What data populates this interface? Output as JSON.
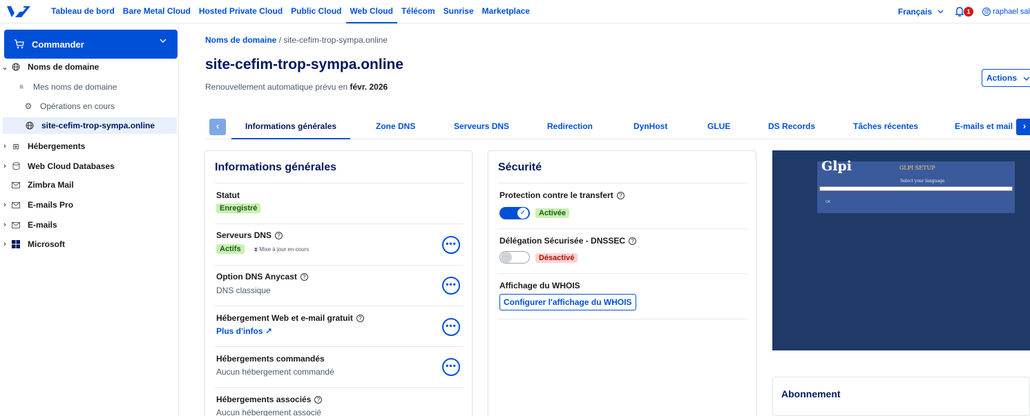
{
  "topnav": {
    "items": [
      "Tableau de bord",
      "Bare Metal Cloud",
      "Hosted Private Cloud",
      "Public Cloud",
      "Web Cloud",
      "Télécom",
      "Sunrise",
      "Marketplace"
    ],
    "active": "Web Cloud",
    "language": "Français",
    "notifications_count": "1",
    "user": "raphael sal"
  },
  "sidebar": {
    "order_label": "Commander",
    "items": [
      {
        "label": "Noms de domaine",
        "icon": "globe-icon"
      },
      {
        "label": "Mes noms de domaine",
        "icon": "list-icon"
      },
      {
        "label": "Opérations en cours",
        "icon": "gear-icon"
      },
      {
        "label": "site-cefim-trop-sympa.online",
        "icon": "globe-icon"
      },
      {
        "label": "Hébergements",
        "icon": "hosting-icon"
      },
      {
        "label": "Web Cloud Databases",
        "icon": "database-icon"
      },
      {
        "label": "Zimbra Mail",
        "icon": "mail-icon"
      },
      {
        "label": "E-mails Pro",
        "icon": "mail-icon"
      },
      {
        "label": "E-mails",
        "icon": "mail-icon"
      },
      {
        "label": "Microsoft",
        "icon": "microsoft-icon"
      }
    ]
  },
  "breadcrumb": {
    "root": "Noms de domaine",
    "separator": "/",
    "current": "site-cefim-trop-sympa.online"
  },
  "page": {
    "title": "site-cefim-trop-sympa.online",
    "renewal_prefix": "Renouvellement automatique prévu en",
    "renewal_date": "févr. 2026",
    "actions_label": "Actions"
  },
  "tabs": [
    "Informations générales",
    "Zone DNS",
    "Serveurs DNS",
    "Redirection",
    "DynHost",
    "GLUE",
    "DS Records",
    "Tâches récentes",
    "E-mails et mail"
  ],
  "general": {
    "title": "Informations générales",
    "status_label": "Statut",
    "status_value": "Enregistré",
    "dns_label": "Serveurs DNS",
    "dns_value": "Actifs",
    "dns_note": "Mise à jour en cours",
    "anycast_label": "Option DNS Anycast",
    "anycast_value": "DNS classique",
    "hosting_free_label": "Hébergement Web et e-mail gratuit",
    "hosting_free_link": "Plus d'infos",
    "hosting_ordered_label": "Hébergements commandés",
    "hosting_ordered_value": "Aucun hébergement commandé",
    "hosting_assoc_label": "Hébergements associés",
    "hosting_assoc_value": "Aucun hébergement associé",
    "dots": "•••"
  },
  "security": {
    "title": "Sécurité",
    "transfer_label": "Protection contre le transfert",
    "transfer_state": "Activée",
    "transfer_on": true,
    "dnssec_label": "Délégation Sécurisée - DNSSEC",
    "dnssec_state": "Désactivé",
    "dnssec_on": false,
    "whois_label": "Affichage du WHOIS",
    "whois_button": "Configurer l'affichage du WHOIS"
  },
  "preview": {
    "logo": "Glpi",
    "setup_title": "GLPI SETUP",
    "select_label": "Select your language",
    "ok": "OK"
  },
  "subscription": {
    "title": "Abonnement"
  },
  "colors": {
    "accent": "#0050d7",
    "navy": "#00185e",
    "green_badge": "#c8f0b4",
    "red_badge": "#fcd3d3"
  }
}
